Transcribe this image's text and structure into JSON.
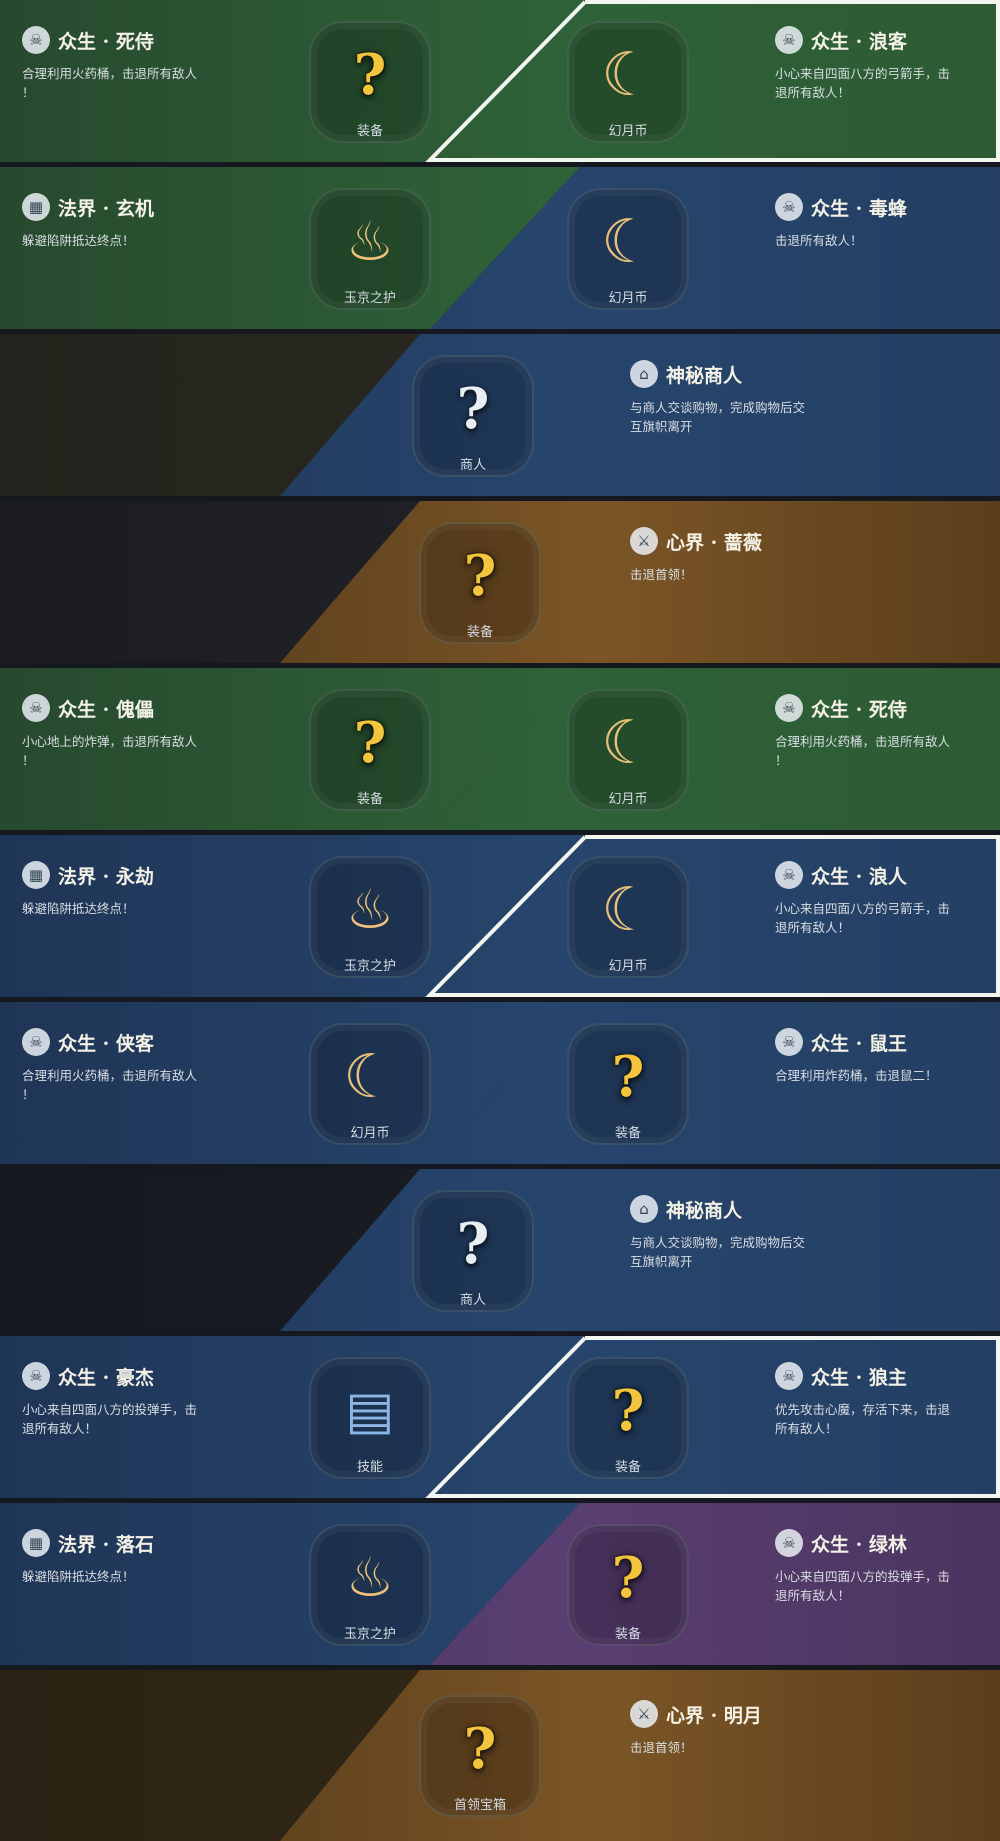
{
  "rows": [
    {
      "left": {
        "title": "众生 · 死侍",
        "desc": "合理利用火药桶，击退所有敌人\n！",
        "icon": "skull-icon",
        "reward": "装备",
        "reward_icon": "mystery-equipment-icon"
      },
      "right": {
        "title": "众生 · 浪客",
        "desc": "小心来自四面八方的弓箭手，击\n退所有敌人！",
        "icon": "skull-icon",
        "reward": "幻月币",
        "reward_icon": "moon-coin-icon"
      }
    },
    {
      "left": {
        "title": "法界 · 玄机",
        "desc": "躲避陷阱抵达终点！",
        "icon": "map-icon",
        "reward": "玉京之护",
        "reward_icon": "flame-icon"
      },
      "right": {
        "title": "众生 · 毒蜂",
        "desc": "击退所有敌人！",
        "icon": "skull-icon",
        "reward": "幻月币",
        "reward_icon": "moon-coin-icon"
      }
    },
    {
      "single": {
        "title": "神秘商人",
        "desc": "与商人交谈购物，完成购物后交\n互旗帜离开",
        "icon": "merchant-icon",
        "reward": "商人",
        "reward_icon": "mystery-merchant-icon"
      }
    },
    {
      "single": {
        "title": "心界 · 蔷薇",
        "desc": "击退首领！",
        "icon": "sword-icon",
        "reward": "装备",
        "reward_icon": "mystery-equipment-icon"
      }
    },
    {
      "left": {
        "title": "众生 · 傀儡",
        "desc": "小心地上的炸弹，击退所有敌人\n！",
        "icon": "skull-icon",
        "reward": "装备",
        "reward_icon": "mystery-equipment-icon"
      },
      "right": {
        "title": "众生 · 死侍",
        "desc": "合理利用火药桶，击退所有敌人\n！",
        "icon": "skull-icon",
        "reward": "幻月币",
        "reward_icon": "moon-coin-icon"
      }
    },
    {
      "left": {
        "title": "法界 · 永劫",
        "desc": "躲避陷阱抵达终点！",
        "icon": "map-icon",
        "reward": "玉京之护",
        "reward_icon": "flame-icon"
      },
      "right": {
        "title": "众生 · 浪人",
        "desc": "小心来自四面八方的弓箭手，击\n退所有敌人！",
        "icon": "skull-icon",
        "reward": "幻月币",
        "reward_icon": "moon-coin-icon"
      }
    },
    {
      "left": {
        "title": "众生 · 侠客",
        "desc": "合理利用火药桶，击退所有敌人\n！",
        "icon": "skull-icon",
        "reward": "幻月币",
        "reward_icon": "moon-coin-icon"
      },
      "right": {
        "title": "众生 · 鼠王",
        "desc": "合理利用炸药桶，击退鼠二！",
        "icon": "skull-icon",
        "reward": "装备",
        "reward_icon": "mystery-equipment-icon"
      }
    },
    {
      "single": {
        "title": "神秘商人",
        "desc": "与商人交谈购物，完成购物后交\n互旗帜离开",
        "icon": "merchant-icon",
        "reward": "商人",
        "reward_icon": "mystery-merchant-icon"
      }
    },
    {
      "left": {
        "title": "众生 · 豪杰",
        "desc": "小心来自四面八方的投弹手，击\n退所有敌人！",
        "icon": "skull-icon",
        "reward": "技能",
        "reward_icon": "skill-book-icon"
      },
      "right": {
        "title": "众生 · 狼主",
        "desc": "优先攻击心魔，存活下来，击退\n所有敌人！",
        "icon": "skull-icon",
        "reward": "装备",
        "reward_icon": "mystery-equipment-icon"
      }
    },
    {
      "left": {
        "title": "法界 · 落石",
        "desc": "躲避陷阱抵达终点！",
        "icon": "map-icon",
        "reward": "玉京之护",
        "reward_icon": "flame-icon"
      },
      "right": {
        "title": "众生 · 绿林",
        "desc": "小心来自四面八方的投弹手，击\n退所有敌人！",
        "icon": "skull-icon",
        "reward": "装备",
        "reward_icon": "mystery-equipment-icon"
      }
    },
    {
      "single": {
        "title": "心界 · 明月",
        "desc": "击退首领！",
        "icon": "sword-icon",
        "reward": "首领宝箱",
        "reward_icon": "boss-chest-icon"
      }
    }
  ],
  "colors": {
    "green": "#2f6238",
    "blue": "#27456d",
    "gold": "#7b5526",
    "purple": "#5a3f73"
  }
}
